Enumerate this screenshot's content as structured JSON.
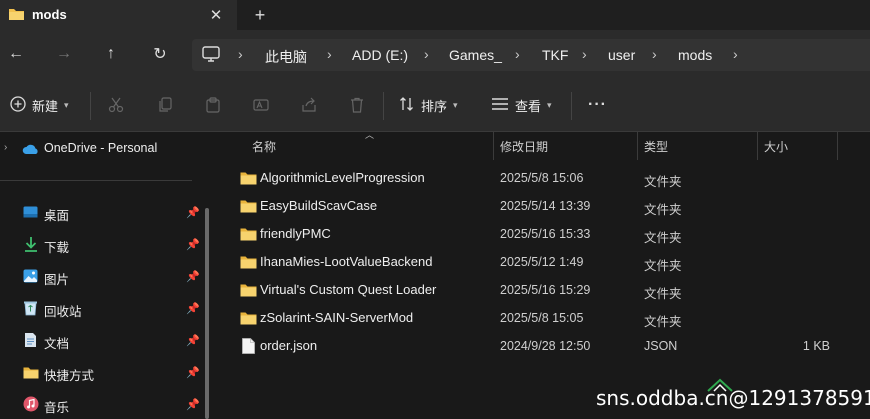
{
  "tab": {
    "title": "mods",
    "close_glyph": "✕",
    "new_tab_glyph": "+"
  },
  "nav": {
    "back": "←",
    "forward": "→",
    "up": "↑",
    "refresh": "↻"
  },
  "breadcrumb": {
    "items": [
      "此电脑",
      "ADD (E:)",
      "Games_",
      "TKF",
      "user",
      "mods"
    ],
    "separator": "›"
  },
  "toolbar": {
    "new_label": "新建",
    "sort_label": "排序",
    "view_label": "查看",
    "more_label": "···"
  },
  "sidebar": {
    "onedrive": "OneDrive - Personal",
    "items": [
      {
        "label": "桌面",
        "icon": "desktop-icon"
      },
      {
        "label": "下载",
        "icon": "download-icon"
      },
      {
        "label": "图片",
        "icon": "pictures-icon"
      },
      {
        "label": "回收站",
        "icon": "recycle-bin-icon"
      },
      {
        "label": "文档",
        "icon": "documents-icon"
      },
      {
        "label": "快捷方式",
        "icon": "folder-icon"
      },
      {
        "label": "音乐",
        "icon": "music-icon"
      }
    ]
  },
  "columns": {
    "name": "名称",
    "modified": "修改日期",
    "type": "类型",
    "size": "大小"
  },
  "files": [
    {
      "name": "AlgorithmicLevelProgression",
      "modified": "2025/5/8 15:06",
      "type": "文件夹",
      "size": "",
      "icon": "folder-icon"
    },
    {
      "name": "EasyBuildScavCase",
      "modified": "2025/5/14 13:39",
      "type": "文件夹",
      "size": "",
      "icon": "folder-icon"
    },
    {
      "name": "friendlyPMC",
      "modified": "2025/5/16 15:33",
      "type": "文件夹",
      "size": "",
      "icon": "folder-icon"
    },
    {
      "name": "IhanaMies-LootValueBackend",
      "modified": "2025/5/12 1:49",
      "type": "文件夹",
      "size": "",
      "icon": "folder-icon"
    },
    {
      "name": "Virtual's Custom Quest Loader",
      "modified": "2025/5/16 15:29",
      "type": "文件夹",
      "size": "",
      "icon": "folder-icon"
    },
    {
      "name": "zSolarint-SAIN-ServerMod",
      "modified": "2025/5/8 15:05",
      "type": "文件夹",
      "size": "",
      "icon": "folder-icon"
    },
    {
      "name": "order.json",
      "modified": "2024/9/28 12:50",
      "type": "JSON",
      "size": "1 KB",
      "icon": "file-icon"
    }
  ],
  "watermark": "sns.oddba.cn@1291378591",
  "colors": {
    "folder": "#f2c14e",
    "background": "#191919",
    "bar": "#2b2b2b",
    "onedrive": "#3aa0e8"
  }
}
